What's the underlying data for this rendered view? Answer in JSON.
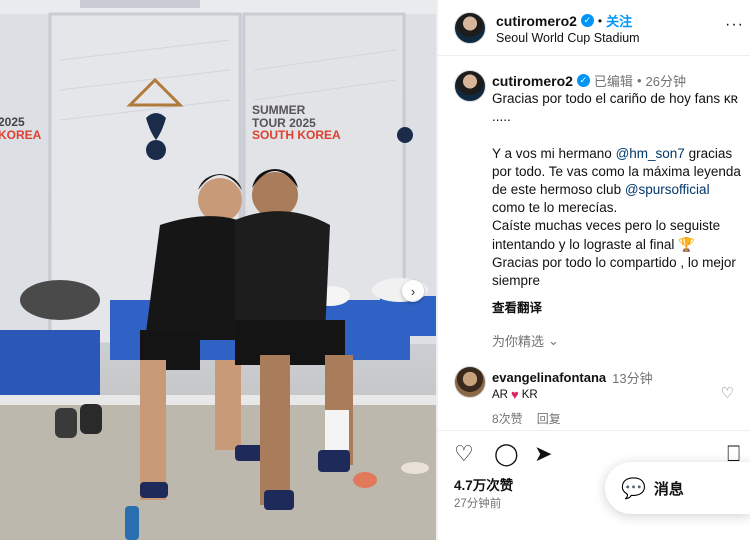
{
  "photo": {
    "tour_left_lines": [
      "2025",
      "KOREA"
    ],
    "tour_mid_lines": [
      "SUMMER",
      "TOUR 2025",
      "SOUTH KOREA"
    ]
  },
  "header": {
    "username": "cutiromero2",
    "follow": "关注",
    "location": "Seoul World Cup Stadium",
    "more": "···"
  },
  "caption": {
    "username": "cutiromero2",
    "edited": "已编辑",
    "time": "26分钟",
    "p1": "Gracias por todo el cariño de hoy fans ᴋʀ .....",
    "p2_pre": "Y a vos mi hermano ",
    "mention1": "@hm_son7",
    "p2_mid": " gracias por todo. Te vas como la máxima leyenda de este hermoso club ",
    "mention2": "@spursofficial",
    "p2_post": " como te lo merecías.",
    "p3": "Caíste muchas veces pero lo seguiste intentando y lo lograste al final 🏆",
    "p4": "Gracias por todo lo compartido , lo mejor siempre",
    "see_translation": "查看翻译",
    "picks": "为你精选"
  },
  "comment": {
    "username": "evangelinafontana",
    "time": "13分钟",
    "text_a": "AR",
    "text_b": "KR",
    "likes": "8次赞",
    "reply": "回复"
  },
  "actions": {
    "likes": "4.7万次赞",
    "time": "27分钟前"
  },
  "messages": {
    "label": "消息"
  },
  "colors": {
    "link": "#0095f6",
    "mention": "#00376b",
    "heart": "#e0245e"
  }
}
